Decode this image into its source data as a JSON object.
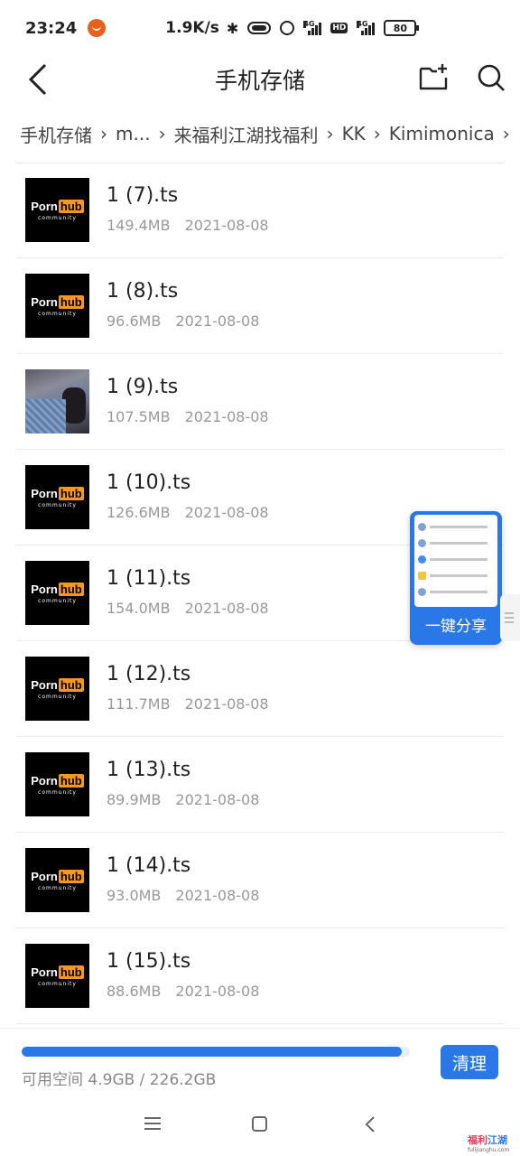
{
  "status_bar": {
    "time": "23:24",
    "net_speed": "1.9K/s",
    "net_tag_1": "4G",
    "net_tag_2": "HD",
    "net_tag_3": "4G",
    "battery": "80"
  },
  "header": {
    "title": "手机存储"
  },
  "breadcrumb": [
    "手机存储",
    "m...",
    "来福利江湖找福利",
    "KK",
    "Kimimonica"
  ],
  "thumb_logo": {
    "porn": "Porn",
    "hub": "hub",
    "sub": "community",
    "accent": "#f7971d"
  },
  "files": [
    {
      "name": "1 (7).ts",
      "size": "149.4MB",
      "date": "2021-08-08",
      "thumb": "logo"
    },
    {
      "name": "1 (8).ts",
      "size": "96.6MB",
      "date": "2021-08-08",
      "thumb": "logo"
    },
    {
      "name": "1 (9).ts",
      "size": "107.5MB",
      "date": "2021-08-08",
      "thumb": "photo"
    },
    {
      "name": "1 (10).ts",
      "size": "126.6MB",
      "date": "2021-08-08",
      "thumb": "logo"
    },
    {
      "name": "1 (11).ts",
      "size": "154.0MB",
      "date": "2021-08-08",
      "thumb": "logo"
    },
    {
      "name": "1 (12).ts",
      "size": "111.7MB",
      "date": "2021-08-08",
      "thumb": "logo"
    },
    {
      "name": "1 (13).ts",
      "size": "89.9MB",
      "date": "2021-08-08",
      "thumb": "logo"
    },
    {
      "name": "1 (14).ts",
      "size": "93.0MB",
      "date": "2021-08-08",
      "thumb": "logo"
    },
    {
      "name": "1 (15).ts",
      "size": "88.6MB",
      "date": "2021-08-08",
      "thumb": "logo"
    }
  ],
  "float_share": {
    "label": "一键分享"
  },
  "storage": {
    "text": "可用空间 4.9GB / 226.2GB",
    "used_fraction": 0.978,
    "clean_label": "清理",
    "accent": "#2a78e8"
  },
  "watermark": {
    "line1_a": "福利",
    "line1_b": "江湖",
    "line2": "fulijianghu.com"
  }
}
